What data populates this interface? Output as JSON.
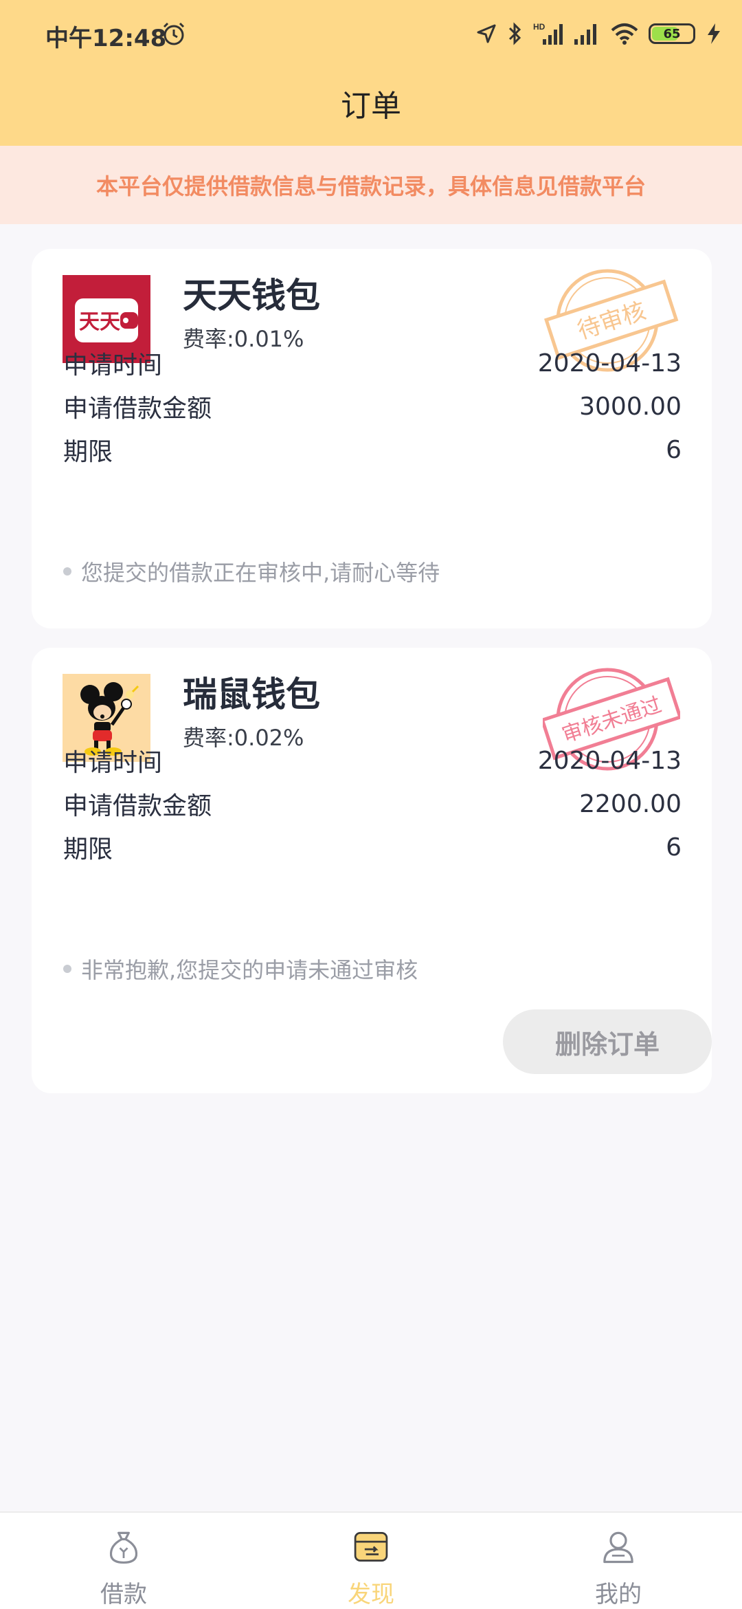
{
  "status_bar": {
    "time": "中午12:48",
    "battery": "65",
    "network_label": "HD"
  },
  "header": {
    "title": "订单"
  },
  "notice": {
    "text": "本平台仅提供借款信息与借款记录，具体信息见借款平台"
  },
  "orders": [
    {
      "name": "天天钱包",
      "rate": "费率:0.01%",
      "logo_text": "天天",
      "stamp": "待审核",
      "stamp_color": "#f6b46b",
      "rows": [
        {
          "label": "申请时间",
          "value": "2020-04-13"
        },
        {
          "label": "申请借款金额",
          "value": "3000.00"
        },
        {
          "label": "期限",
          "value": "6"
        }
      ],
      "note": "您提交的借款正在审核中,请耐心等待"
    },
    {
      "name": "瑞鼠钱包",
      "rate": "费率:0.02%",
      "stamp": "审核未通过",
      "stamp_color": "#ee5f7a",
      "rows": [
        {
          "label": "申请时间",
          "value": "2020-04-13"
        },
        {
          "label": "申请借款金额",
          "value": "2200.00"
        },
        {
          "label": "期限",
          "value": "6"
        }
      ],
      "note": "非常抱歉,您提交的申请未通过审核",
      "delete_label": "删除订单"
    }
  ],
  "nav": [
    {
      "label": "借款",
      "icon": "money-bag-icon"
    },
    {
      "label": "发现",
      "icon": "discover-icon",
      "active": true
    },
    {
      "label": "我的",
      "icon": "user-icon"
    }
  ],
  "colors": {
    "header_bg": "#fed989",
    "notice_bg": "#fde8e0",
    "notice_text": "#f28b62",
    "nav_active": "#f9d57a"
  }
}
